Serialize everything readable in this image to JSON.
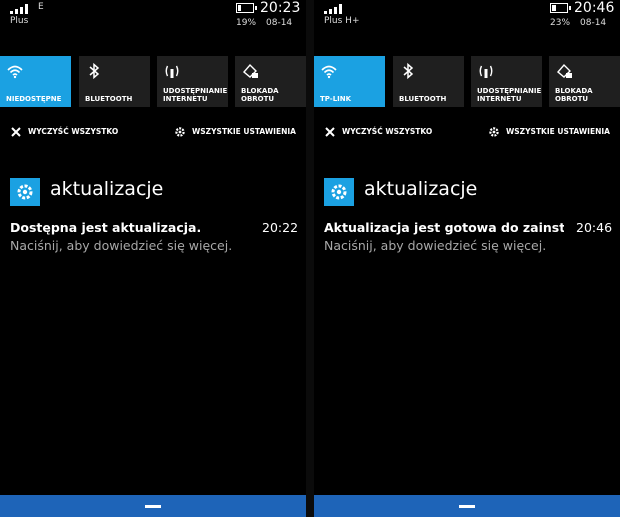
{
  "colors": {
    "accent": "#1ba1e2",
    "tile_off": "#1f1f1f",
    "bottom_bar": "#1e64b8",
    "secondary_text": "#a8a8a8"
  },
  "panels": [
    {
      "status": {
        "net_type": "E",
        "carrier": "Plus",
        "time": "20:23",
        "battery_pct": "19%",
        "battery_level": 0.19,
        "date": "08-14"
      },
      "quick_actions": [
        {
          "label": "NIEDOSTĘPNE",
          "icon": "wifi-icon",
          "active": true
        },
        {
          "label": "BLUETOOTH",
          "icon": "bluetooth-icon",
          "active": false
        },
        {
          "label": "UDOSTĘPNIANIE INTERNETU",
          "icon": "hotspot-icon",
          "active": false
        },
        {
          "label": "BLOKADA OBROTU",
          "icon": "rotation-lock-icon",
          "active": false
        }
      ],
      "clear_all": "WYCZYŚĆ WSZYSTKO",
      "all_settings": "WSZYSTKIE USTAWIENIA",
      "notification": {
        "app": "aktualizacje",
        "title": "Dostępna jest aktualizacja.",
        "time": "20:22",
        "body": "Naciśnij, aby dowiedzieć się więcej."
      }
    },
    {
      "status": {
        "net_type": "",
        "carrier": "Plus H+",
        "time": "20:46",
        "battery_pct": "23%",
        "battery_level": 0.23,
        "date": "08-14"
      },
      "quick_actions": [
        {
          "label": "TP-LINK",
          "icon": "wifi-icon",
          "active": true
        },
        {
          "label": "BLUETOOTH",
          "icon": "bluetooth-icon",
          "active": false
        },
        {
          "label": "UDOSTĘPNIANIE INTERNETU",
          "icon": "hotspot-icon",
          "active": false
        },
        {
          "label": "BLOKADA OBROTU",
          "icon": "rotation-lock-icon",
          "active": false
        }
      ],
      "clear_all": "WYCZYŚĆ WSZYSTKO",
      "all_settings": "WSZYSTKIE USTAWIENIA",
      "notification": {
        "app": "aktualizacje",
        "title": "Aktualizacja jest gotowa do zainst",
        "time": "20:46",
        "body": "Naciśnij, aby dowiedzieć się więcej."
      }
    }
  ]
}
